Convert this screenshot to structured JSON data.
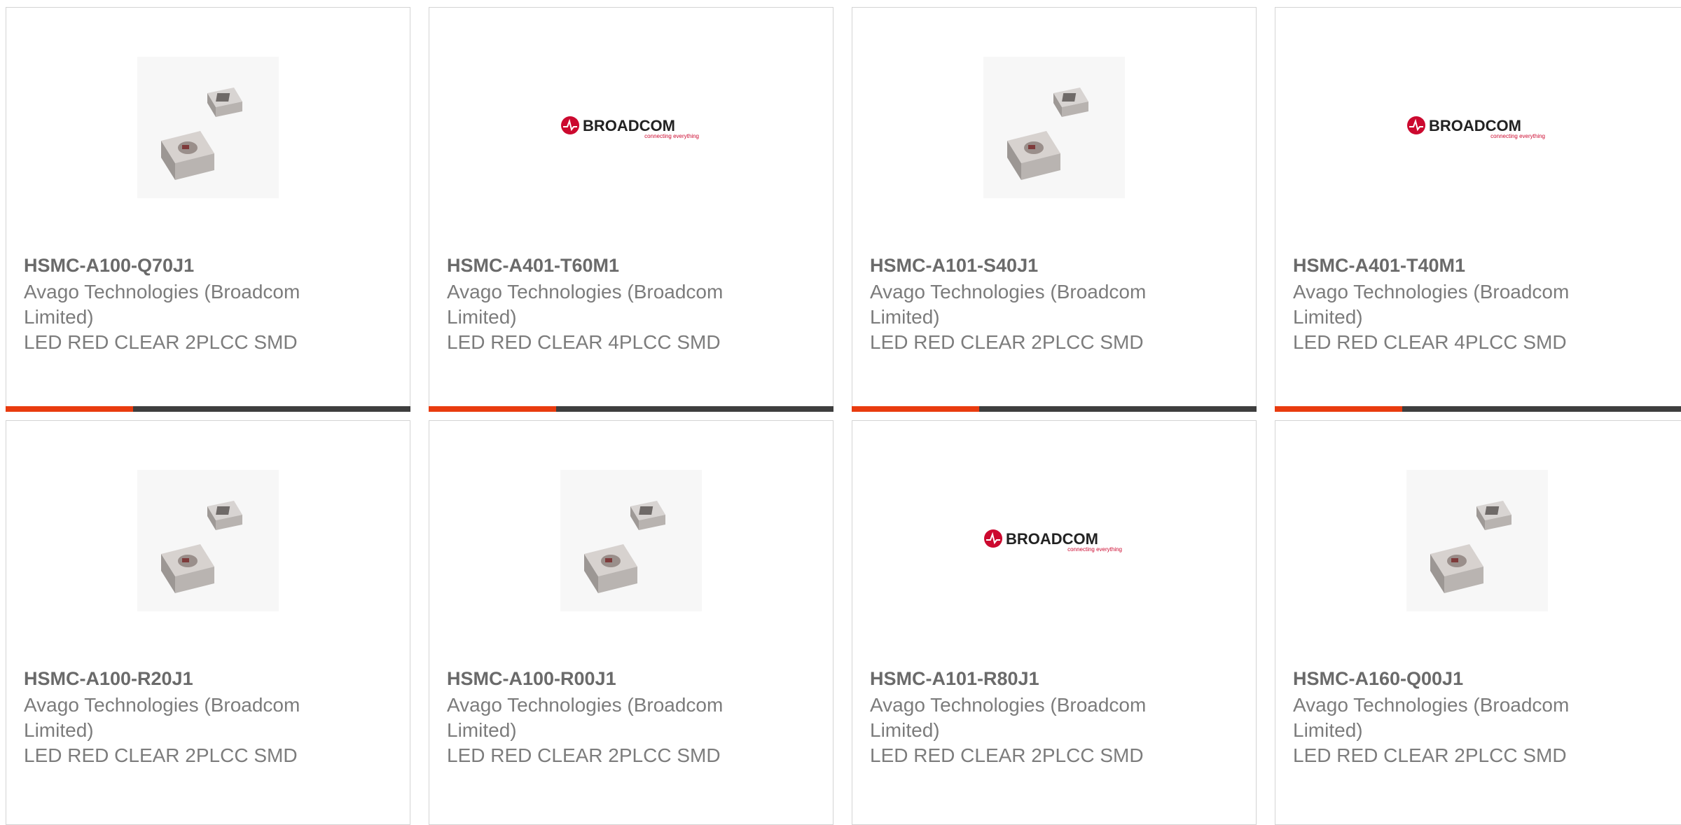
{
  "colors": {
    "accent": "#e93b0f",
    "bar": "#3e3e3e",
    "brand_red": "#cc092f",
    "text": "#7c7c7c"
  },
  "products": [
    {
      "part_number": "HSMC-A100-Q70J1",
      "manufacturer": "Avago Technologies (Broadcom Limited)",
      "description": "LED RED CLEAR 2PLCC SMD",
      "image": "led-photo"
    },
    {
      "part_number": "HSMC-A401-T60M1",
      "manufacturer": "Avago Technologies (Broadcom Limited)",
      "description": "LED RED CLEAR 4PLCC SMD",
      "image": "broadcom-logo"
    },
    {
      "part_number": "HSMC-A101-S40J1",
      "manufacturer": "Avago Technologies (Broadcom Limited)",
      "description": "LED RED CLEAR 2PLCC SMD",
      "image": "led-photo"
    },
    {
      "part_number": "HSMC-A401-T40M1",
      "manufacturer": "Avago Technologies (Broadcom Limited)",
      "description": "LED RED CLEAR 4PLCC SMD",
      "image": "broadcom-logo"
    },
    {
      "part_number": "HSMC-A100-R20J1",
      "manufacturer": "Avago Technologies (Broadcom Limited)",
      "description": "LED RED CLEAR 2PLCC SMD",
      "image": "led-photo"
    },
    {
      "part_number": "HSMC-A100-R00J1",
      "manufacturer": "Avago Technologies (Broadcom Limited)",
      "description": "LED RED CLEAR 2PLCC SMD",
      "image": "led-photo"
    },
    {
      "part_number": "HSMC-A101-R80J1",
      "manufacturer": "Avago Technologies (Broadcom Limited)",
      "description": "LED RED CLEAR 2PLCC SMD",
      "image": "broadcom-logo"
    },
    {
      "part_number": "HSMC-A160-Q00J1",
      "manufacturer": "Avago Technologies (Broadcom Limited)",
      "description": "LED RED CLEAR 2PLCC SMD",
      "image": "led-photo"
    }
  ],
  "logo": {
    "wordmark": "BROADCOM",
    "tagline": "connecting everything"
  }
}
